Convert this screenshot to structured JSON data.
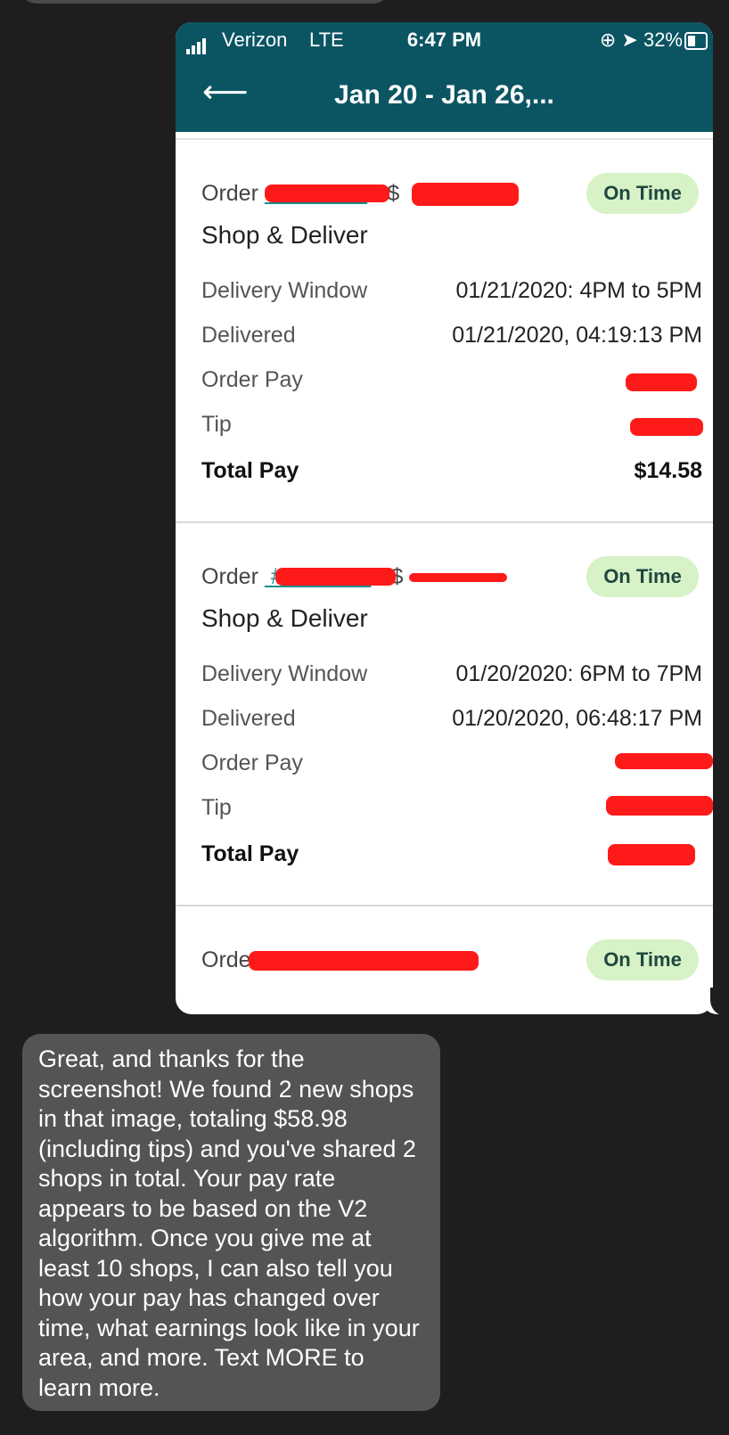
{
  "status_bar": {
    "carrier": "Verizon",
    "network": "LTE",
    "time": "6:47 PM",
    "battery": "32%"
  },
  "header": {
    "title": "Jan 20 - Jan 26,..."
  },
  "orders": [
    {
      "order_label": "Order",
      "status": "On Time",
      "service": "Shop & Deliver",
      "rows": [
        {
          "label": "Delivery Window",
          "value": "01/21/2020:  4PM to  5PM"
        },
        {
          "label": "Delivered",
          "value": "01/21/2020, 04:19:13 PM"
        },
        {
          "label": "Order Pay",
          "value": ""
        },
        {
          "label": "Tip",
          "value": ""
        },
        {
          "label": "Total Pay",
          "value": "$14.58"
        }
      ]
    },
    {
      "order_label": "Order",
      "status": "On Time",
      "service": "Shop & Deliver",
      "rows": [
        {
          "label": "Delivery Window",
          "value": "01/20/2020:  6PM to  7PM"
        },
        {
          "label": "Delivered",
          "value": "01/20/2020, 06:48:17 PM"
        },
        {
          "label": "Order Pay",
          "value": ""
        },
        {
          "label": "Tip",
          "value": ""
        },
        {
          "label": "Total Pay",
          "value": ""
        }
      ]
    },
    {
      "order_label": "Order",
      "status": "On Time"
    }
  ],
  "message": {
    "text": "Great, and thanks for the screenshot! We found 2 new shops in that image, totaling $58.98 (including tips) and you've shared 2 shops in total. Your pay rate appears to be based on the V2 algorithm. Once you give me at least 10 shops, I can also tell you how your pay has changed over time, what earnings look like in your area, and more. Text MORE to learn more."
  },
  "colors": {
    "header_bg": "#0b5563",
    "badge_bg": "#d7f2c6",
    "redaction": "#ff1a1a",
    "incoming_bubble": "#545454"
  }
}
